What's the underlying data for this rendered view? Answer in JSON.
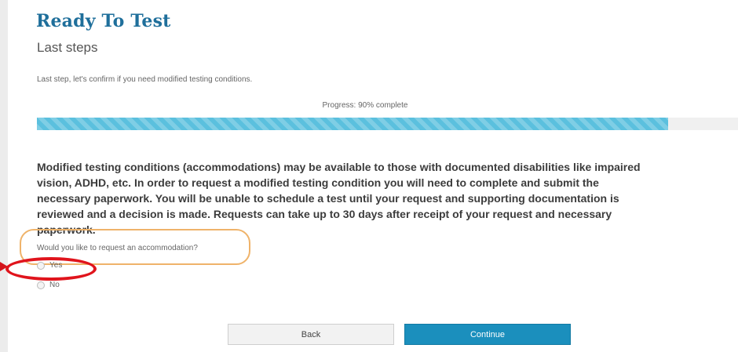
{
  "header": {
    "title": "Ready To Test",
    "subtitle": "Last steps"
  },
  "intro_text": "Last step, let's confirm if you need modified testing conditions.",
  "progress": {
    "label": "Progress: 90% complete",
    "percent": 90,
    "color": "#5bc0de"
  },
  "notice": "Modified testing conditions (accommodations) may be available to those with documented disabilities like impaired vision, ADHD, etc. In order to request a modified testing condition you will need to complete and submit the necessary paperwork. You will be unable to schedule a test until your request and supporting documentation is reviewed and a decision is made. Requests can take up to 30 days after receipt of your request and necessary paperwork.",
  "question": {
    "label": "Would you like to request an accommodation?",
    "options": [
      {
        "label": "Yes",
        "selected": false
      },
      {
        "label": "No",
        "selected": false
      }
    ]
  },
  "buttons": {
    "back": "Back",
    "continue": "Continue"
  },
  "colors": {
    "title": "#1f6f9b",
    "continue_button": "#1b8fbd",
    "annotation_red": "#e0141c",
    "annotation_orange": "#efb36a"
  }
}
